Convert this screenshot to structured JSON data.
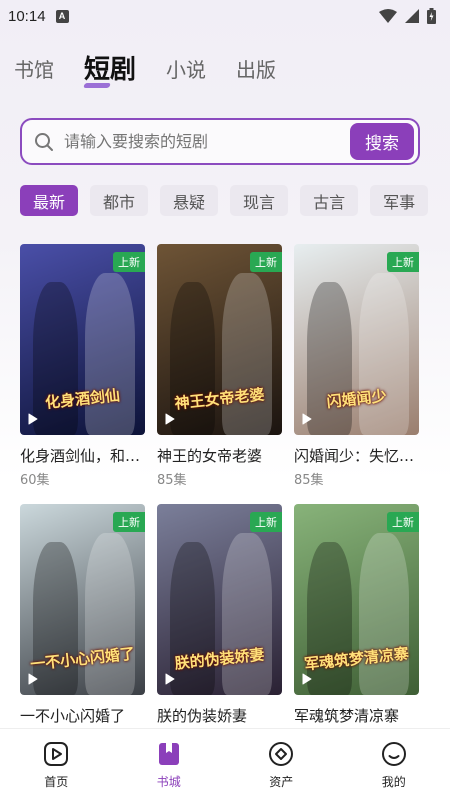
{
  "status_bar": {
    "time": "10:14",
    "notification_letter": "A"
  },
  "top_tabs": [
    {
      "label": "书馆",
      "active": false
    },
    {
      "label": "短剧",
      "active": true
    },
    {
      "label": "小说",
      "active": false
    },
    {
      "label": "出版",
      "active": false
    }
  ],
  "search": {
    "placeholder": "请输入要搜索的短剧",
    "button_label": "搜索"
  },
  "categories": [
    "最新",
    "都市",
    "悬疑",
    "现言",
    "古言",
    "军事"
  ],
  "dramas": [
    {
      "title": "化身酒剑仙，和校花一起拯救世界",
      "episodes": "60集",
      "badge": "上新",
      "cover_text": "化身酒剑仙",
      "colors": [
        "#4a4fa8",
        "#0d1338"
      ]
    },
    {
      "title": "神王的女帝老婆",
      "episodes": "85集",
      "badge": "上新",
      "cover_text": "神王女帝老婆",
      "colors": [
        "#6e5436",
        "#1b1410"
      ]
    },
    {
      "title": "闪婚闻少：失忆娇妻藏马甲",
      "episodes": "85集",
      "badge": "上新",
      "cover_text": "闪婚闻少",
      "colors": [
        "#e7eef0",
        "#9a7e6e"
      ]
    },
    {
      "title": "一不小心闪婚了",
      "episodes": "",
      "badge": "上新",
      "cover_text": "一不小心闪婚了",
      "colors": [
        "#cbd8dc",
        "#3b3f45"
      ]
    },
    {
      "title": "朕的伪装娇妻",
      "episodes": "",
      "badge": "上新",
      "cover_text": "朕的伪装娇妻",
      "colors": [
        "#7b7f9a",
        "#2a2133"
      ]
    },
    {
      "title": "军魂筑梦清凉寨",
      "episodes": "",
      "badge": "上新",
      "cover_text": "军魂筑梦清凉寨",
      "colors": [
        "#88b37a",
        "#3f5f35"
      ]
    }
  ],
  "bottom_nav": [
    {
      "label": "首页",
      "icon": "play-square-icon",
      "active": false
    },
    {
      "label": "书城",
      "icon": "bookmark-icon",
      "active": true
    },
    {
      "label": "资产",
      "icon": "diamond-circle-icon",
      "active": false
    },
    {
      "label": "我的",
      "icon": "smile-icon",
      "active": false
    }
  ],
  "theme": {
    "accent": "#8b3fba",
    "badge": "#29a853"
  }
}
